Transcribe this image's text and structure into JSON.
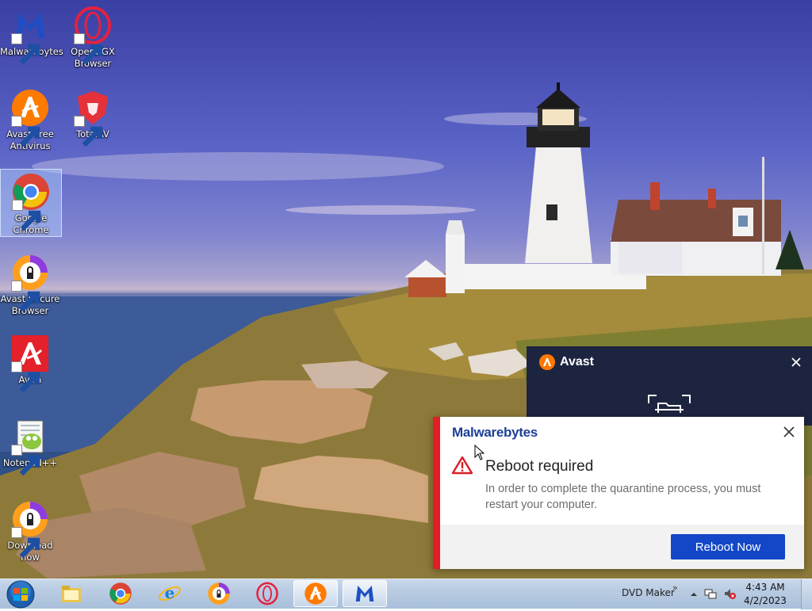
{
  "desktop": {
    "icons": [
      {
        "label": "Malwarebytes",
        "icon": "malwarebytes-icon"
      },
      {
        "label": "Opera GX Browser",
        "icon": "opera-gx-icon"
      },
      {
        "label": "Avast Free Antivirus",
        "icon": "avast-icon"
      },
      {
        "label": "TotalAV",
        "icon": "totalav-icon"
      },
      {
        "label": "Google Chrome",
        "icon": "chrome-icon"
      },
      {
        "label": "Avast Secure Browser",
        "icon": "avast-secure-browser-icon"
      },
      {
        "label": "Avira",
        "icon": "avira-icon"
      },
      {
        "label": "Notepad++",
        "icon": "notepadpp-icon"
      },
      {
        "label": "Download now",
        "icon": "avast-secure-browser-icon"
      }
    ]
  },
  "avast_popup": {
    "brand": "Avast"
  },
  "malwarebytes_toast": {
    "brand": "Malwarebytes",
    "title": "Reboot required",
    "body": "In order to complete the quarantine process, you must restart your computer.",
    "button": "Reboot Now",
    "accent": "#e41c23",
    "button_color": "#1347c7"
  },
  "taskbar": {
    "pinned": [
      "start-orb-icon",
      "file-explorer-icon",
      "chrome-icon",
      "internet-explorer-icon",
      "avast-secure-browser-icon",
      "opera-icon",
      "avast-icon",
      "malwarebytes-icon"
    ],
    "tray_label": "DVD Maker",
    "tray_chevron": "»",
    "clock_time": "4:43 AM",
    "clock_date": "4/2/2023"
  }
}
